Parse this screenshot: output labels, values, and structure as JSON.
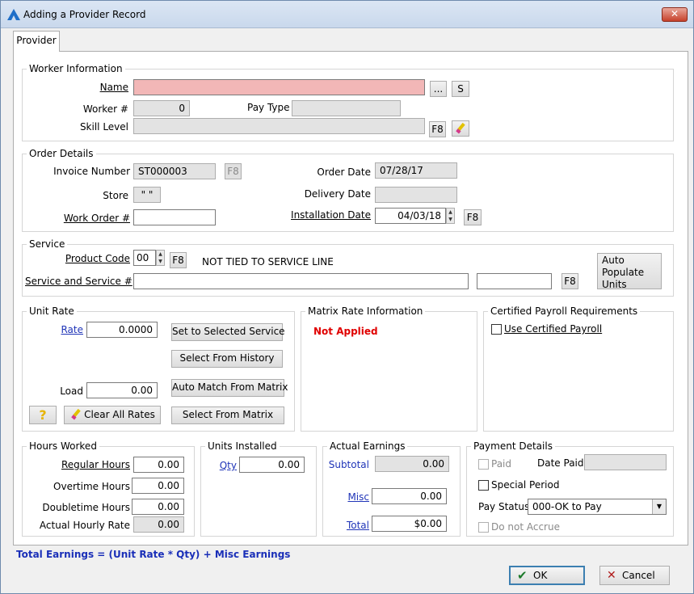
{
  "window": {
    "title": "Adding a Provider Record"
  },
  "tab": {
    "label": "Provider"
  },
  "worker_information": {
    "title": "Worker Information",
    "name_label": "Name",
    "name_value": "",
    "ellipsis_button": "...",
    "s_button": "S",
    "worker_label": "Worker #",
    "worker_value": "0",
    "pay_type_label": "Pay Type",
    "pay_type_value": "",
    "skill_level_label": "Skill Level",
    "skill_level_value": "",
    "f8_button": "F8"
  },
  "order_details": {
    "title": "Order Details",
    "invoice_label": "Invoice Number",
    "invoice_value": "ST000003",
    "invoice_f8": "F8",
    "store_label": "Store",
    "store_value": "\" \"",
    "work_order_label": "Work Order #",
    "work_order_value": "",
    "order_date_label": "Order Date",
    "order_date_value": "07/28/17",
    "delivery_date_label": "Delivery Date",
    "delivery_date_value": "",
    "installation_date_label": "Installation Date",
    "installation_date_value": "04/03/18",
    "installation_f8": "F8"
  },
  "service": {
    "title": "Service",
    "product_code_label": "Product Code",
    "product_code_value": "00",
    "product_code_f8": "F8",
    "not_tied_text": "NOT TIED TO SERVICE LINE",
    "auto_populate_button": "Auto Populate Units",
    "service_label": "Service and Service #",
    "service_value": "",
    "service_num_value": "",
    "service_f8": "F8"
  },
  "unit_rate": {
    "title": "Unit Rate",
    "rate_label": "Rate",
    "rate_value": "0.0000",
    "load_label": "Load",
    "load_value": "0.00",
    "set_selected_button": "Set to Selected Service",
    "select_history_button": "Select From History",
    "auto_match_button": "Auto Match From Matrix",
    "select_matrix_button": "Select From Matrix",
    "help_icon": "?",
    "clear_all_button": "Clear All Rates"
  },
  "matrix_rate": {
    "title": "Matrix Rate Information",
    "status": "Not Applied"
  },
  "certified_payroll": {
    "title": "Certified Payroll Requirements",
    "use_certified_label": "Use Certified Payroll"
  },
  "hours_worked": {
    "title": "Hours Worked",
    "regular_label": "Regular Hours",
    "regular_value": "0.00",
    "overtime_label": "Overtime Hours",
    "overtime_value": "0.00",
    "doubletime_label": "Doubletime Hours",
    "doubletime_value": "0.00",
    "actual_hourly_label": "Actual Hourly Rate",
    "actual_hourly_value": "0.00"
  },
  "units_installed": {
    "title": "Units Installed",
    "qty_label": "Qty",
    "qty_value": "0.00"
  },
  "actual_earnings": {
    "title": "Actual Earnings",
    "subtotal_label": "Subtotal",
    "subtotal_value": "0.00",
    "misc_label": "Misc",
    "misc_value": "0.00",
    "total_label": "Total",
    "total_value": "$0.00"
  },
  "payment_details": {
    "title": "Payment Details",
    "paid_label": "Paid",
    "date_paid_label": "Date Paid",
    "date_paid_value": "",
    "special_period_label": "Special Period",
    "pay_status_label": "Pay Status",
    "pay_status_value": "000-OK to Pay",
    "do_not_accrue_label": "Do not Accrue"
  },
  "footer": {
    "formula": "Total Earnings = (Unit Rate * Qty) + Misc Earnings",
    "ok_button": "OK",
    "cancel_button": "Cancel"
  },
  "icons": [
    "app-logo-icon",
    "close-icon",
    "eraser-icon",
    "help-icon",
    "checkmark-icon",
    "x-icon",
    "spin-up-icon",
    "spin-down-icon",
    "dropdown-arrow-icon"
  ]
}
